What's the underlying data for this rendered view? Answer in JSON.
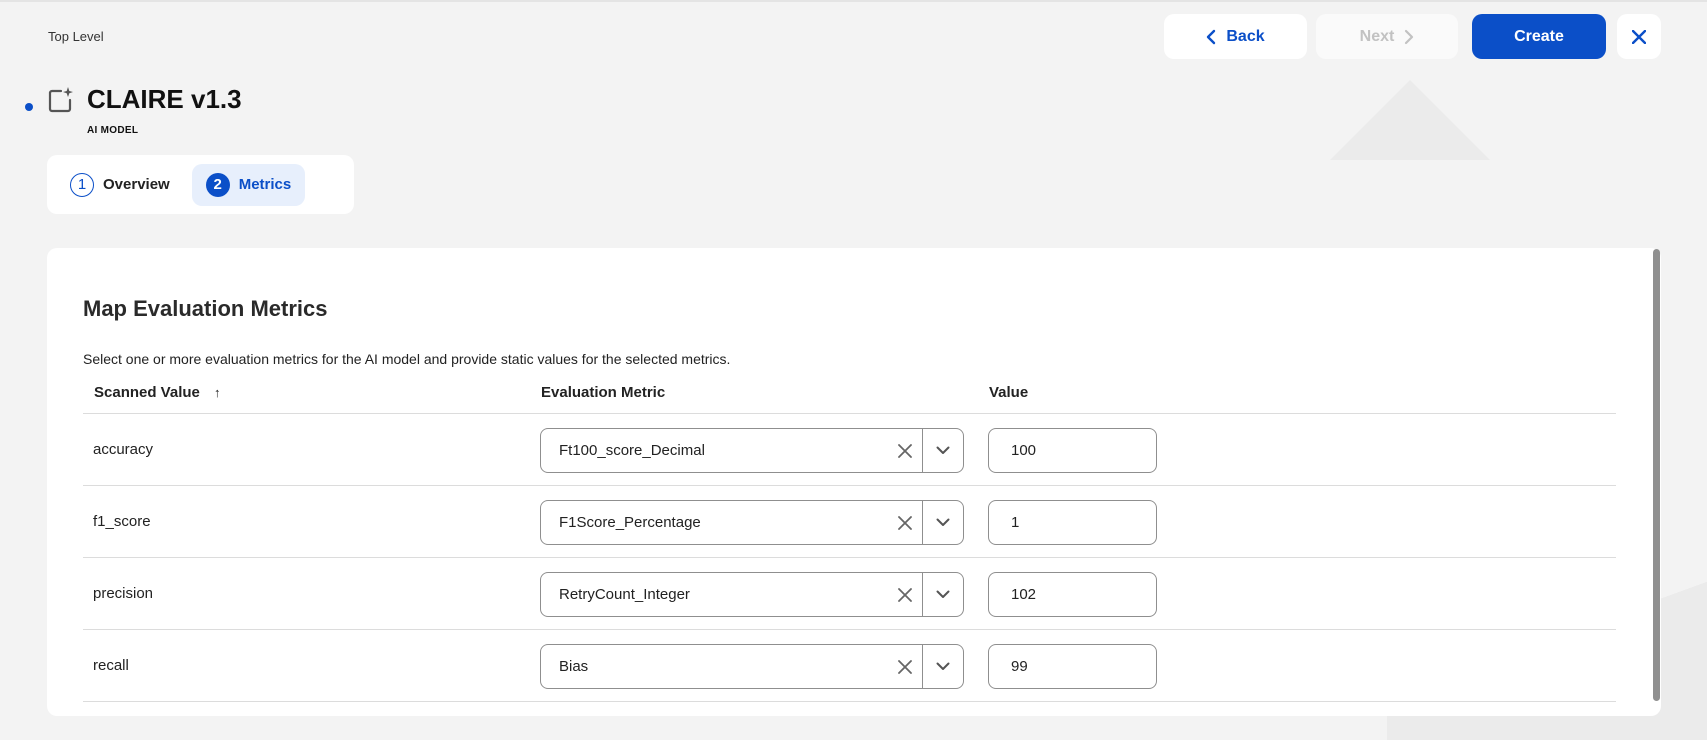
{
  "breadcrumb": "Top Level",
  "toolbar": {
    "back_label": "Back",
    "next_label": "Next",
    "create_label": "Create"
  },
  "model": {
    "title": "CLAIRE v1.3",
    "type": "AI MODEL"
  },
  "steps": [
    {
      "num": "1",
      "label": "Overview"
    },
    {
      "num": "2",
      "label": "Metrics"
    }
  ],
  "card": {
    "title": "Map Evaluation Metrics",
    "description": "Select one or more evaluation metrics for the AI model and provide static values for the selected metrics."
  },
  "table": {
    "headers": {
      "scanned": "Scanned Value",
      "metric": "Evaluation Metric",
      "value": "Value"
    },
    "rows": [
      {
        "scanned": "accuracy",
        "metric": "Ft100_score_Decimal",
        "value": "100"
      },
      {
        "scanned": "f1_score",
        "metric": "F1Score_Percentage",
        "value": "1"
      },
      {
        "scanned": "precision",
        "metric": "RetryCount_Integer",
        "value": "102"
      },
      {
        "scanned": "recall",
        "metric": "Bias",
        "value": "99"
      }
    ]
  },
  "colors": {
    "accent": "#0b4fc8",
    "background": "#f3f3f3"
  }
}
